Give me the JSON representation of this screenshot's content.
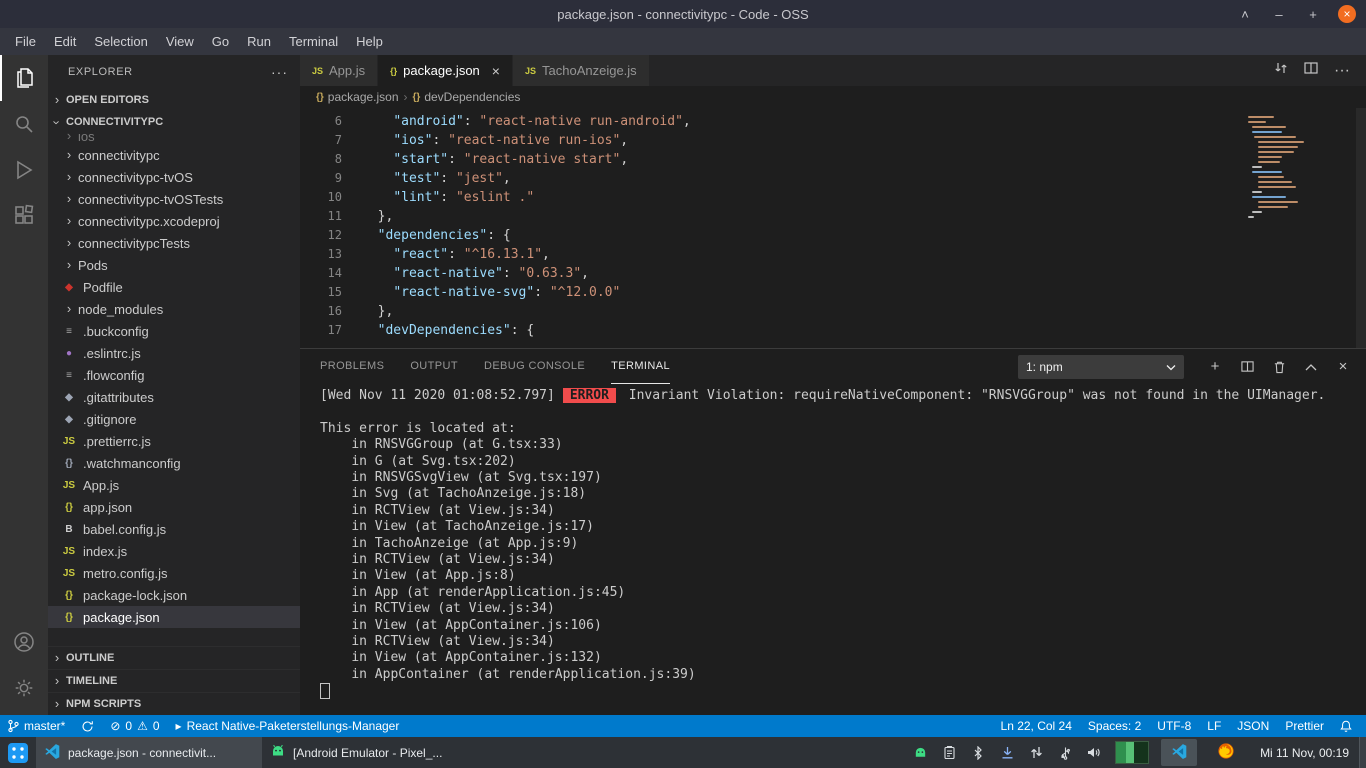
{
  "window": {
    "title": "package.json - connectivitypc - Code - OSS"
  },
  "menubar": {
    "items": [
      "File",
      "Edit",
      "Selection",
      "View",
      "Go",
      "Run",
      "Terminal",
      "Help"
    ]
  },
  "activity_bar": {
    "top": [
      {
        "name": "explorer",
        "active": true
      },
      {
        "name": "search",
        "active": false
      },
      {
        "name": "run-debug",
        "active": false
      },
      {
        "name": "extensions",
        "active": false
      }
    ],
    "bottom": [
      {
        "name": "account"
      },
      {
        "name": "settings"
      }
    ]
  },
  "sidebar": {
    "header": "EXPLORER",
    "open_editors_label": "OPEN EDITORS",
    "root_label": "CONNECTIVITYPC",
    "tree": [
      {
        "label": "ios",
        "kind": "folder",
        "clipped": true
      },
      {
        "label": "connectivitypc",
        "kind": "folder"
      },
      {
        "label": "connectivitypc-tvOS",
        "kind": "folder"
      },
      {
        "label": "connectivitypc-tvOSTests",
        "kind": "folder"
      },
      {
        "label": "connectivitypc.xcodeproj",
        "kind": "folder"
      },
      {
        "label": "connectivitypcTests",
        "kind": "folder"
      },
      {
        "label": "Pods",
        "kind": "folder"
      },
      {
        "label": "Podfile",
        "kind": "file",
        "icon": "ruby"
      },
      {
        "label": "node_modules",
        "kind": "folder"
      },
      {
        "label": ".buckconfig",
        "kind": "file",
        "icon": "config"
      },
      {
        "label": ".eslintrc.js",
        "kind": "file",
        "icon": "eslint"
      },
      {
        "label": ".flowconfig",
        "kind": "file",
        "icon": "config"
      },
      {
        "label": ".gitattributes",
        "kind": "file",
        "icon": "git"
      },
      {
        "label": ".gitignore",
        "kind": "file",
        "icon": "git"
      },
      {
        "label": ".prettierrc.js",
        "kind": "file",
        "icon": "js"
      },
      {
        "label": ".watchmanconfig",
        "kind": "file",
        "icon": "json-gray"
      },
      {
        "label": "App.js",
        "kind": "file",
        "icon": "js"
      },
      {
        "label": "app.json",
        "kind": "file",
        "icon": "json"
      },
      {
        "label": "babel.config.js",
        "kind": "file",
        "icon": "babel"
      },
      {
        "label": "index.js",
        "kind": "file",
        "icon": "js"
      },
      {
        "label": "metro.config.js",
        "kind": "file",
        "icon": "js"
      },
      {
        "label": "package-lock.json",
        "kind": "file",
        "icon": "json"
      },
      {
        "label": "package.json",
        "kind": "file",
        "icon": "json",
        "selected": true
      }
    ],
    "bottom_sections": [
      "OUTLINE",
      "TIMELINE",
      "NPM SCRIPTS"
    ]
  },
  "editor_tabs": [
    {
      "label": "App.js",
      "icon": "js",
      "active": false
    },
    {
      "label": "package.json",
      "icon": "json",
      "active": true
    },
    {
      "label": "TachoAnzeige.js",
      "icon": "js",
      "active": false
    }
  ],
  "breadcrumb": {
    "items": [
      "package.json",
      "devDependencies"
    ]
  },
  "editor": {
    "lines": [
      {
        "num": "6",
        "tokens": [
          [
            "plain",
            "    "
          ],
          [
            "key",
            "\"android\""
          ],
          [
            "plain",
            ": "
          ],
          [
            "str",
            "\"react-native run-android\""
          ],
          [
            "plain",
            ","
          ]
        ]
      },
      {
        "num": "7",
        "tokens": [
          [
            "plain",
            "    "
          ],
          [
            "key",
            "\"ios\""
          ],
          [
            "plain",
            ": "
          ],
          [
            "str",
            "\"react-native run-ios\""
          ],
          [
            "plain",
            ","
          ]
        ]
      },
      {
        "num": "8",
        "tokens": [
          [
            "plain",
            "    "
          ],
          [
            "key",
            "\"start\""
          ],
          [
            "plain",
            ": "
          ],
          [
            "str",
            "\"react-native start\""
          ],
          [
            "plain",
            ","
          ]
        ]
      },
      {
        "num": "9",
        "tokens": [
          [
            "plain",
            "    "
          ],
          [
            "key",
            "\"test\""
          ],
          [
            "plain",
            ": "
          ],
          [
            "str",
            "\"jest\""
          ],
          [
            "plain",
            ","
          ]
        ]
      },
      {
        "num": "10",
        "tokens": [
          [
            "plain",
            "    "
          ],
          [
            "key",
            "\"lint\""
          ],
          [
            "plain",
            ": "
          ],
          [
            "str",
            "\"eslint .\""
          ]
        ]
      },
      {
        "num": "11",
        "tokens": [
          [
            "plain",
            "  },"
          ]
        ]
      },
      {
        "num": "12",
        "tokens": [
          [
            "plain",
            "  "
          ],
          [
            "key",
            "\"dependencies\""
          ],
          [
            "plain",
            ": {"
          ]
        ]
      },
      {
        "num": "13",
        "tokens": [
          [
            "plain",
            "    "
          ],
          [
            "key",
            "\"react\""
          ],
          [
            "plain",
            ": "
          ],
          [
            "str",
            "\"^16.13.1\""
          ],
          [
            "plain",
            ","
          ]
        ]
      },
      {
        "num": "14",
        "tokens": [
          [
            "plain",
            "    "
          ],
          [
            "key",
            "\"react-native\""
          ],
          [
            "plain",
            ": "
          ],
          [
            "str",
            "\"0.63.3\""
          ],
          [
            "plain",
            ","
          ]
        ]
      },
      {
        "num": "15",
        "tokens": [
          [
            "plain",
            "    "
          ],
          [
            "key",
            "\"react-native-svg\""
          ],
          [
            "plain",
            ": "
          ],
          [
            "str",
            "\"^12.0.0\""
          ]
        ]
      },
      {
        "num": "16",
        "tokens": [
          [
            "plain",
            "  },"
          ]
        ]
      },
      {
        "num": "17",
        "tokens": [
          [
            "plain",
            "  "
          ],
          [
            "key",
            "\"devDependencies\""
          ],
          [
            "plain",
            ": {"
          ]
        ]
      }
    ]
  },
  "panel": {
    "tabs": [
      {
        "label": "PROBLEMS",
        "active": false
      },
      {
        "label": "OUTPUT",
        "active": false
      },
      {
        "label": "DEBUG CONSOLE",
        "active": false
      },
      {
        "label": "TERMINAL",
        "active": true
      }
    ],
    "dropdown": "1: npm"
  },
  "terminal": {
    "error_line": {
      "timestamp": "[Wed Nov 11 2020 01:08:52.797]",
      "badge": "ERROR",
      "message": "Invariant Violation: requireNativeComponent: \"RNSVGGroup\" was not found in the UIManager."
    },
    "lines": [
      "",
      "This error is located at:",
      "    in RNSVGGroup (at G.tsx:33)",
      "    in G (at Svg.tsx:202)",
      "    in RNSVGSvgView (at Svg.tsx:197)",
      "    in Svg (at TachoAnzeige.js:18)",
      "    in RCTView (at View.js:34)",
      "    in View (at TachoAnzeige.js:17)",
      "    in TachoAnzeige (at App.js:9)",
      "    in RCTView (at View.js:34)",
      "    in View (at App.js:8)",
      "    in App (at renderApplication.js:45)",
      "    in RCTView (at View.js:34)",
      "    in View (at AppContainer.js:106)",
      "    in RCTView (at View.js:34)",
      "    in View (at AppContainer.js:132)",
      "    in AppContainer (at renderApplication.js:39)"
    ]
  },
  "statusbar": {
    "left": [
      {
        "name": "git-branch",
        "icon": "branch",
        "label": "master*"
      },
      {
        "name": "sync-status",
        "icon": "sync",
        "label": ""
      },
      {
        "name": "problems",
        "segments": [
          {
            "icon": "error",
            "label": "0"
          },
          {
            "icon": "warning",
            "label": "0"
          }
        ]
      },
      {
        "name": "rn-packager",
        "icon": "play",
        "label": "React Native-Paketerstellungs-Manager"
      }
    ],
    "right": [
      {
        "name": "cursor-position",
        "label": "Ln 22, Col 24"
      },
      {
        "name": "indentation",
        "label": "Spaces: 2"
      },
      {
        "name": "encoding",
        "label": "UTF-8"
      },
      {
        "name": "eol",
        "label": "LF"
      },
      {
        "name": "language-mode",
        "label": "JSON"
      },
      {
        "name": "formatter",
        "label": "Prettier"
      },
      {
        "name": "notifications",
        "icon": "bell",
        "label": ""
      }
    ]
  },
  "taskbar": {
    "tasks": [
      {
        "name": "vscode-task",
        "icon": "vscode",
        "label": "package.json - connectivit...",
        "active": true
      },
      {
        "name": "emulator-task",
        "icon": "android",
        "label": "[Android Emulator - Pixel_...",
        "active": false
      }
    ],
    "tray": [
      "android",
      "clipboard",
      "bluetooth",
      "updates",
      "network",
      "devices",
      "volume"
    ],
    "tray_apps": [
      {
        "name": "emulator-window",
        "icon": "emulator",
        "active": false
      },
      {
        "name": "vscode-window",
        "icon": "vscode",
        "active": true
      },
      {
        "name": "firefox-window",
        "icon": "firefox",
        "active": false
      }
    ],
    "clock": "Mi 11 Nov, 00:19"
  }
}
